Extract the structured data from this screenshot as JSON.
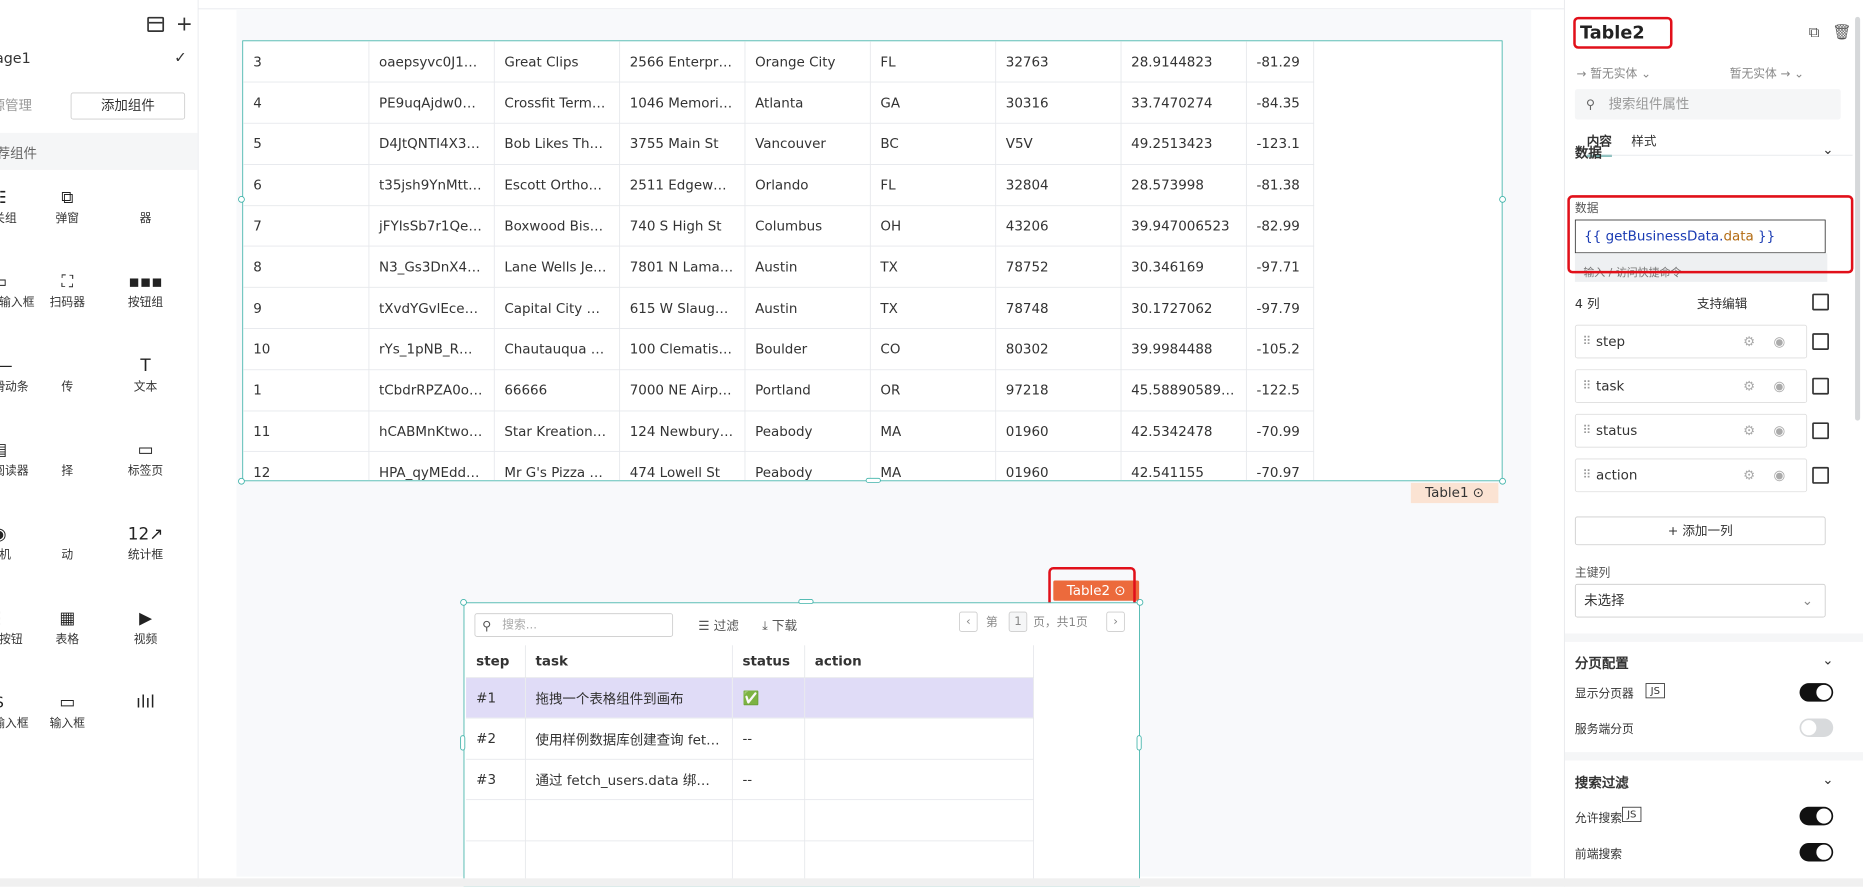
{
  "left": {
    "page_name": "age1",
    "tab_datasource": "源管理",
    "tab_add": "添加组件",
    "section": "荐组件",
    "components": [
      {
        "icon": "☷",
        "label": "开关组"
      },
      {
        "icon": "⧉",
        "label": "弹窗"
      },
      {
        "icon": "",
        "label": "器"
      },
      {
        "icon": "▭",
        "label": "手机号输入框"
      },
      {
        "icon": "⛶",
        "label": "扫码器"
      },
      {
        "icon": "▪▪▪",
        "label": "按钮组"
      },
      {
        "icon": "•—",
        "label": "数字滑动条"
      },
      {
        "icon": "",
        "label": "传"
      },
      {
        "icon": "T",
        "label": "文本"
      },
      {
        "icon": "▤",
        "label": "文档阅读器"
      },
      {
        "icon": "",
        "label": "择"
      },
      {
        "icon": "▭",
        "label": "标签页"
      },
      {
        "icon": "◉",
        "label": "相机"
      },
      {
        "icon": "",
        "label": "动"
      },
      {
        "icon": "12↗",
        "label": "统计框"
      },
      {
        "icon": "⋮",
        "label": "菜单按钮"
      },
      {
        "icon": "▦",
        "label": "表格"
      },
      {
        "icon": "▶",
        "label": "视频"
      },
      {
        "icon": "$",
        "label": "货币输入框"
      },
      {
        "icon": "▭",
        "label": "输入框"
      },
      {
        "icon": "ılıl",
        "label": ""
      }
    ]
  },
  "table1": {
    "tag": "Table1",
    "rows": [
      [
        "3",
        "oaepsyvc0J17qwi...",
        "Great Clips",
        "2566 Enterprise Rd",
        "Orange City",
        "FL",
        "32763",
        "28.9144823",
        "-81.29"
      ],
      [
        "4",
        "PE9uqAjdw0E4-8...",
        "Crossfit Terminus",
        "1046 Memorial Dr ...",
        "Atlanta",
        "GA",
        "30316",
        "33.7470274",
        "-84.35"
      ],
      [
        "5",
        "D4JtQNTI4X3Kcbz...",
        "Bob Likes Thai Food",
        "3755 Main St",
        "Vancouver",
        "BC",
        "V5V",
        "49.2513423",
        "-123.1"
      ],
      [
        "6",
        "t35jsh9YnMtttm69...",
        "Escott Orthodontics",
        "2511 Edgewater Dr",
        "Orlando",
        "FL",
        "32804",
        "28.573998",
        "-81.38"
      ],
      [
        "7",
        "jFYIsSb7r1QeESV...",
        "Boxwood Biscuit",
        "740 S High St",
        "Columbus",
        "OH",
        "43206",
        "39.947006523",
        "-82.99"
      ],
      [
        "8",
        "N3_Gs3DnX4k9Sg...",
        "Lane Wells Jewelr...",
        "7801 N Lamar Blv...",
        "Austin",
        "TX",
        "78752",
        "30.346169",
        "-97.71"
      ],
      [
        "9",
        "tXvdYGvlEceDljN8...",
        "Capital City Barber...",
        "615 W Slaughter ...",
        "Austin",
        "TX",
        "78748",
        "30.1727062",
        "-97.79"
      ],
      [
        "10",
        "rYs_1pNB_RMtn5...",
        "Chautauqua Gener...",
        "100 Clematis Dr",
        "Boulder",
        "CO",
        "80302",
        "39.9984488",
        "-105.2"
      ],
      [
        "1",
        "tCbdrRPZA0oiIYS...",
        "66666",
        "7000 NE Airport ...",
        "Portland",
        "OR",
        "97218",
        "45.5889058992",
        "-122.5"
      ],
      [
        "11",
        "hCABMnKtwo4Y9...",
        "Star Kreations Sal...",
        "124 Newbury St, ...",
        "Peabody",
        "MA",
        "01960",
        "42.5342478",
        "-70.99"
      ],
      [
        "12",
        "HPA_qyMEddpAEt...",
        "Mr G's Pizza & Subs",
        "474 Lowell St",
        "Peabody",
        "MA",
        "01960",
        "42.541155",
        "-70.97"
      ]
    ]
  },
  "table2": {
    "tag": "Table2",
    "search_placeholder": "搜索...",
    "filter_label": "过滤",
    "download_label": "下载",
    "pager_prefix": "第",
    "pager_page": "1",
    "pager_suffix": "页，共1页",
    "columns": [
      "step",
      "task",
      "status",
      "action"
    ],
    "rows": [
      {
        "step": "#1",
        "task": "拖拽一个表格组件到画布",
        "status": "✅",
        "action": ""
      },
      {
        "step": "#2",
        "task": "使用样例数据库创建查询 fetch_us...",
        "status": "--",
        "action": ""
      },
      {
        "step": "#3",
        "task": "通过 fetch_users.data 绑定查询数据",
        "status": "--",
        "action": ""
      }
    ]
  },
  "right": {
    "title": "Table2",
    "entity_left": "→ 暂无实体 ⌄",
    "entity_right": "暂无实体 → ⌄",
    "search_placeholder": "搜索组件属性",
    "tab_content": "内容",
    "tab_style": "样式",
    "data_section": "数据",
    "data_label": "数据",
    "code_open": "{{ getBusinessData.",
    "code_key": "data",
    "code_close": "  }}",
    "hint": "输入 / 访问快捷命令",
    "columns_count": "4 列",
    "support_edit": "支持编辑",
    "columns": [
      "step",
      "task",
      "status",
      "action"
    ],
    "add_column": "+ 添加一列",
    "primary_key_label": "主键列",
    "primary_key_value": "未选择",
    "pagination_section": "分页配置",
    "show_pager": "显示分页器",
    "server_pagination": "服务端分页",
    "search_filter_section": "搜索过滤",
    "allow_search": "允许搜索",
    "frontend_search": "前端搜索",
    "js": "JS"
  },
  "colors": {
    "accent_teal": "#3fb3a9",
    "tag_orange": "#ec6a3c",
    "highlight_red": "#e1101a",
    "selected_row": "#e0dcf7"
  }
}
